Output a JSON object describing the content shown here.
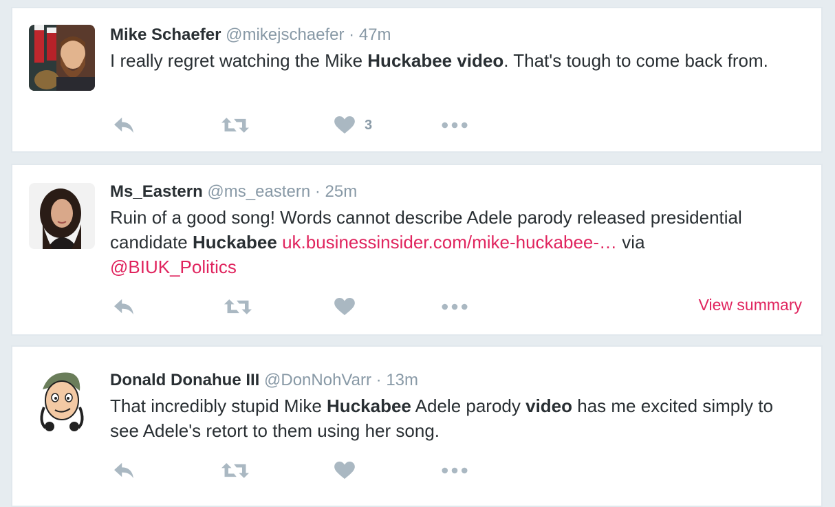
{
  "tweets": [
    {
      "name": "Mike Schaefer",
      "handle": "@mikejschaefer",
      "sep": " · ",
      "time": "47m",
      "text_parts": [
        "I really regret watching the Mike ",
        "Huckabee video",
        ". That's tough to come back from."
      ],
      "like_count": "3",
      "icons": [
        "reply-icon",
        "retweet-icon",
        "heart-icon",
        "more-icon"
      ]
    },
    {
      "name": "Ms_Eastern",
      "handle": "@ms_eastern",
      "sep": " · ",
      "time": "25m",
      "text_parts": [
        "Ruin of a good song! Words cannot describe Adele parody released presidential candidate ",
        "Huckabee",
        " ",
        "uk.businessinsider.com/mike-huckabee-…",
        " via ",
        "@BIUK_Politics"
      ],
      "view_summary": "View summary",
      "icons": [
        "reply-icon",
        "retweet-icon",
        "heart-icon",
        "more-icon"
      ]
    },
    {
      "name": "Donald Donahue III",
      "handle": "@DonNohVarr",
      "sep": " · ",
      "time": "13m",
      "text_parts": [
        "That incredibly stupid Mike ",
        "Huckabee",
        " Adele parody ",
        "video",
        " has me excited simply to see Adele's retort to them using her song."
      ],
      "icons": [
        "reply-icon",
        "retweet-icon",
        "heart-icon",
        "more-icon"
      ]
    }
  ],
  "colors": {
    "link": "#e0245e",
    "muted": "#8899a6",
    "icon": "#aab8c2",
    "background": "#e6ecf0"
  }
}
